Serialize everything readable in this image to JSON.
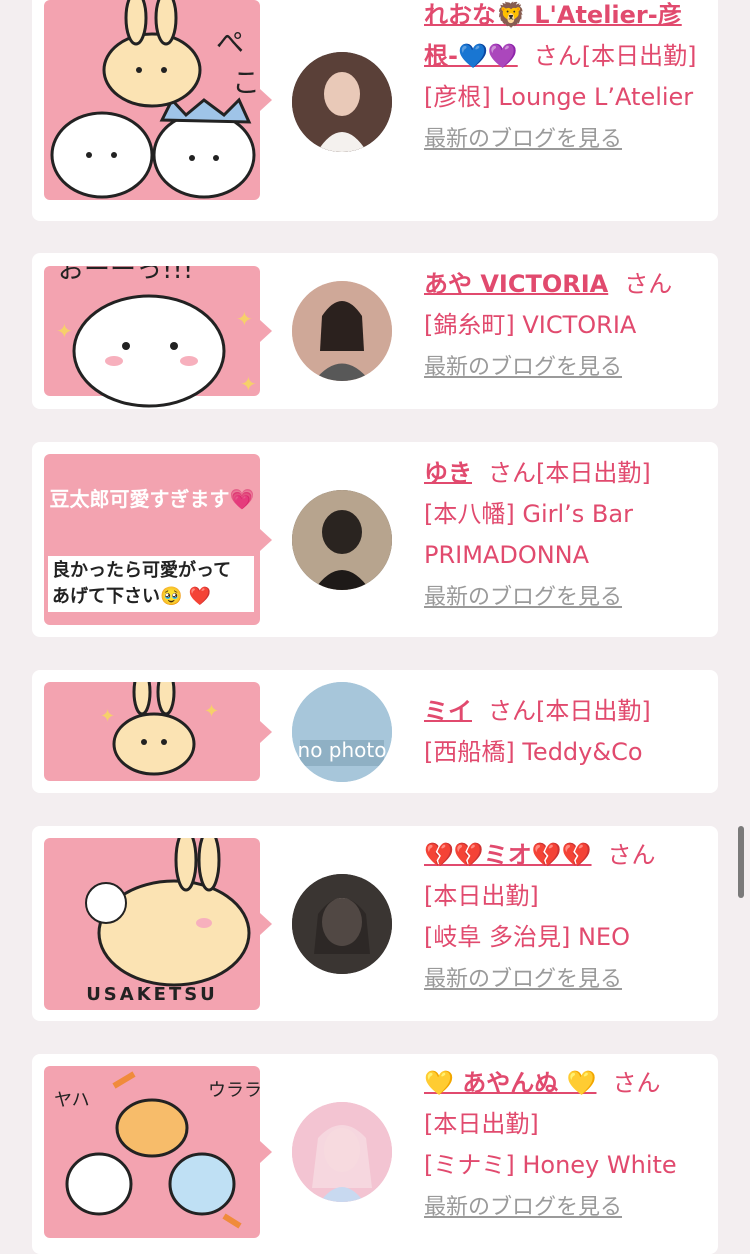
{
  "entries": [
    {
      "name": "れおな🦁 L'Atelier-彦根-💙💜",
      "san": "さん",
      "meta": "[本日出勤]",
      "shop": "[彦根] Lounge L’Atelier",
      "blog": "最新のブログを見る",
      "sticker_text": "ぺこ",
      "avatar_color": "#3b2a2a"
    },
    {
      "name": "あや VICTORIA",
      "san": "さん",
      "meta": "",
      "shop": "[錦糸町] VICTORIA",
      "blog": "最新のブログを見る",
      "sticker_text": "おーーっ!!!",
      "avatar_color": "#d9b6a8"
    },
    {
      "name": "ゆき",
      "san": "さん",
      "meta": "[本日出勤]",
      "shop": "[本八幡] Girl’s Bar PRIMADONNA",
      "blog": "最新のブログを見る",
      "sticker_text": "豆太郎可愛すぎます💗",
      "sticker_sub": "良かったら可愛がって あげて下さい🥹 ❤️",
      "avatar_color": "#4b4036"
    },
    {
      "name": "ミイ",
      "san": "さん",
      "meta": "[本日出勤]",
      "shop": "[西船橋] Teddy&Co",
      "blog": "",
      "sticker_text": "",
      "avatar_color": "#9fc1d6",
      "avatar_text": "no photo"
    },
    {
      "name": "💔💔ミオ💔💔",
      "san": "さん",
      "meta": "[本日出勤]",
      "shop": "[岐阜 多治見] NEO",
      "blog": "最新のブログを見る",
      "sticker_text": "USAKETSU",
      "avatar_color": "#2d2a28"
    },
    {
      "name": "💛 あやんぬ 💛",
      "san": "さん",
      "meta": "[本日出勤]",
      "shop": "[ミナミ] Honey White",
      "blog": "最新のブログを見る",
      "sticker_text": "ヤハ ウララ",
      "avatar_color": "#f0b8c8"
    }
  ]
}
